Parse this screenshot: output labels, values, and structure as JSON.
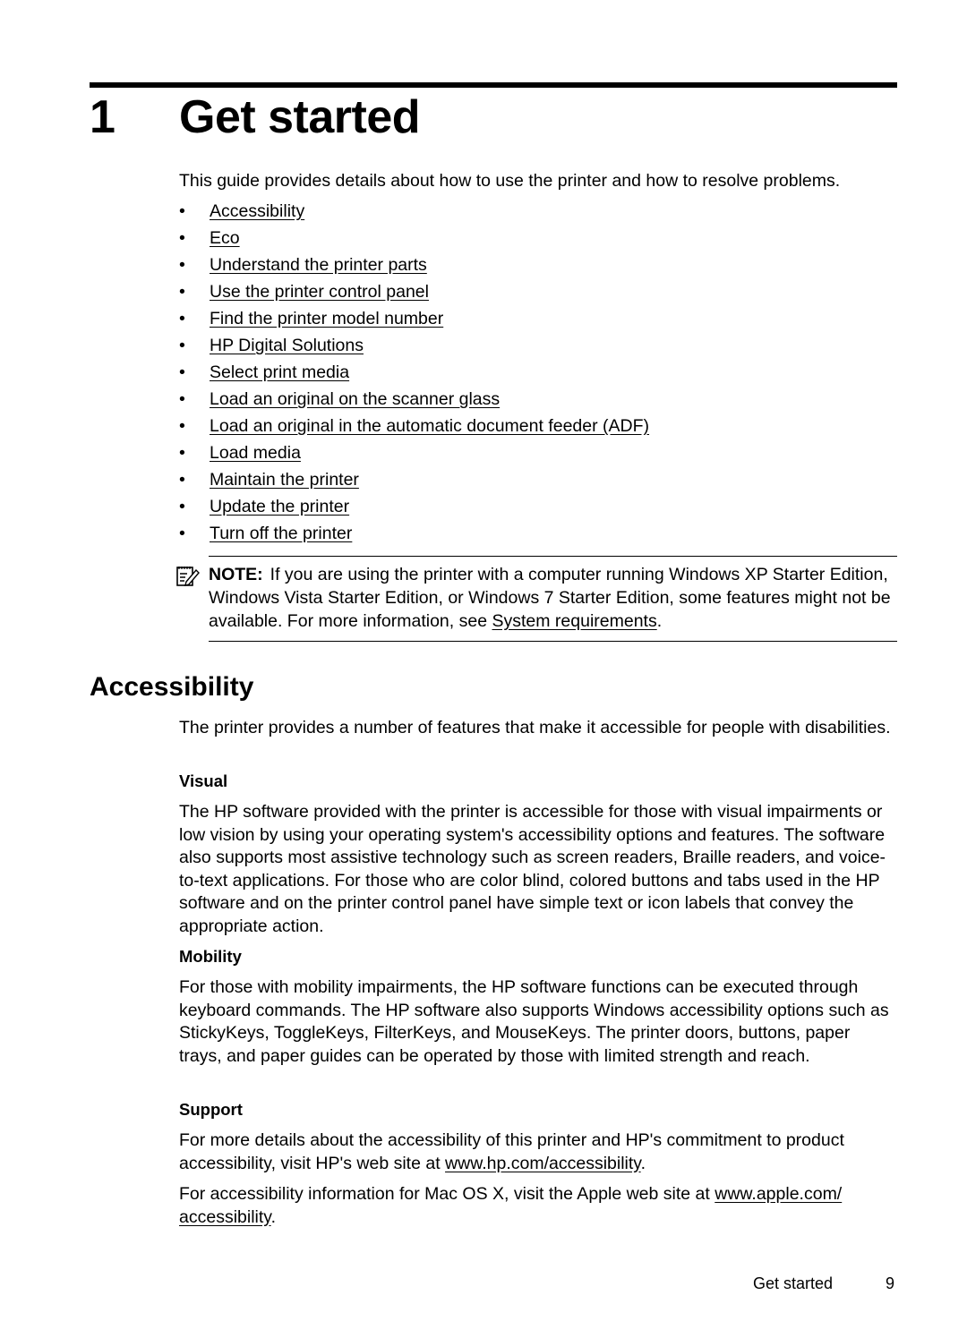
{
  "chapter": {
    "number": "1",
    "title": "Get started",
    "intro": "This guide provides details about how to use the printer and how to resolve problems.",
    "bullet_glyph": "•",
    "links": [
      {
        "label": "Accessibility"
      },
      {
        "label": "Eco"
      },
      {
        "label": "Understand the printer parts"
      },
      {
        "label": "Use the printer control panel"
      },
      {
        "label": "Find the printer model number"
      },
      {
        "label": "HP Digital Solutions"
      },
      {
        "label": "Select print media"
      },
      {
        "label": "Load an original on the scanner glass"
      },
      {
        "label": "Load an original in the automatic document feeder (ADF)"
      },
      {
        "label": "Load media"
      },
      {
        "label": "Maintain the printer"
      },
      {
        "label": "Update the printer"
      },
      {
        "label": "Turn off the printer"
      }
    ]
  },
  "note": {
    "icon": "note-pencil-icon",
    "label": "NOTE:",
    "text": "If you are using the printer with a computer running Windows XP Starter Edition, Windows Vista Starter Edition, or Windows 7 Starter Edition, some features might not be available. For more information, see ",
    "link": "System requirements",
    "after": "."
  },
  "accessibility": {
    "heading": "Accessibility",
    "intro": "The printer provides a number of features that make it accessible for people with disabilities.",
    "visual": {
      "heading": "Visual",
      "text": "The HP software provided with the printer is accessible for those with visual impairments or low vision by using your operating system's accessibility options and features. The software also supports most assistive technology such as screen readers, Braille readers, and voice-to-text applications. For those who are color blind, colored buttons and tabs used in the HP software and on the printer control panel have simple text or icon labels that convey the appropriate action."
    },
    "mobility": {
      "heading": "Mobility",
      "text": "For those with mobility impairments, the HP software functions can be executed through keyboard commands. The HP software also supports Windows accessibility options such as StickyKeys, ToggleKeys, FilterKeys, and MouseKeys. The printer doors, buttons, paper trays, and paper guides can be operated by those with limited strength and reach."
    },
    "support": {
      "heading": "Support",
      "p1_text": "For more details about the accessibility of this printer and HP's commitment to product accessibility, visit HP's web site at ",
      "p1_link": "www.hp.com/accessibility",
      "p1_after": ".",
      "p2_text": "For accessibility information for Mac OS X, visit the Apple web site at ",
      "p2_link": "www.apple.com/ accessibility",
      "p2_after": "."
    }
  },
  "footer": {
    "section": "Get started",
    "page": "9"
  }
}
